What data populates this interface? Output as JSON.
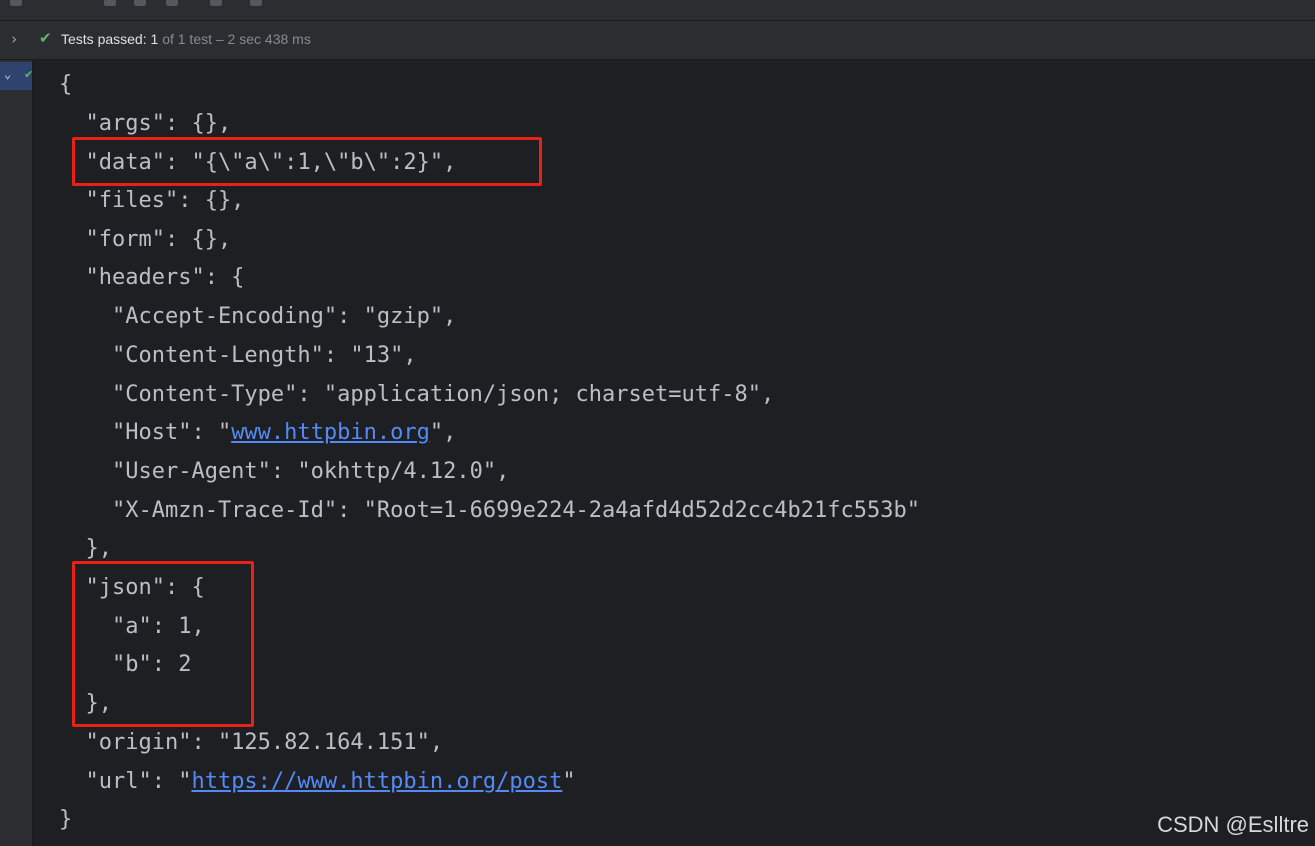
{
  "status": {
    "passed_label": "Tests passed:",
    "passed_count": "1",
    "detail": "of 1 test – 2 sec 438 ms"
  },
  "output_lines": [
    "{",
    "  \"args\": {},",
    "  \"data\": \"{\\\"a\\\":1,\\\"b\\\":2}\",",
    "  \"files\": {},",
    "  \"form\": {},",
    "  \"headers\": {",
    "    \"Accept-Encoding\": \"gzip\",",
    "    \"Content-Length\": \"13\",",
    "    \"Content-Type\": \"application/json; charset=utf-8\",",
    "    \"Host\": \"",
    "    \"User-Agent\": \"okhttp/4.12.0\",",
    "    \"X-Amzn-Trace-Id\": \"Root=1-6699e224-2a4afd4d52d2cc4b21fc553b\"",
    "  },",
    "  \"json\": {",
    "    \"a\": 1,",
    "    \"b\": 2",
    "  },",
    "  \"origin\": \"125.82.164.151\",",
    "  \"url\": \"",
    "}"
  ],
  "links": {
    "host": "www.httpbin.org",
    "host_suffix": "\",",
    "url": "https://www.httpbin.org/post",
    "url_suffix": "\""
  },
  "watermark": "CSDN @Eslltre",
  "colors": {
    "pass_green": "#5fb865",
    "highlight_red": "#e8201a",
    "link_blue": "#548af7"
  }
}
